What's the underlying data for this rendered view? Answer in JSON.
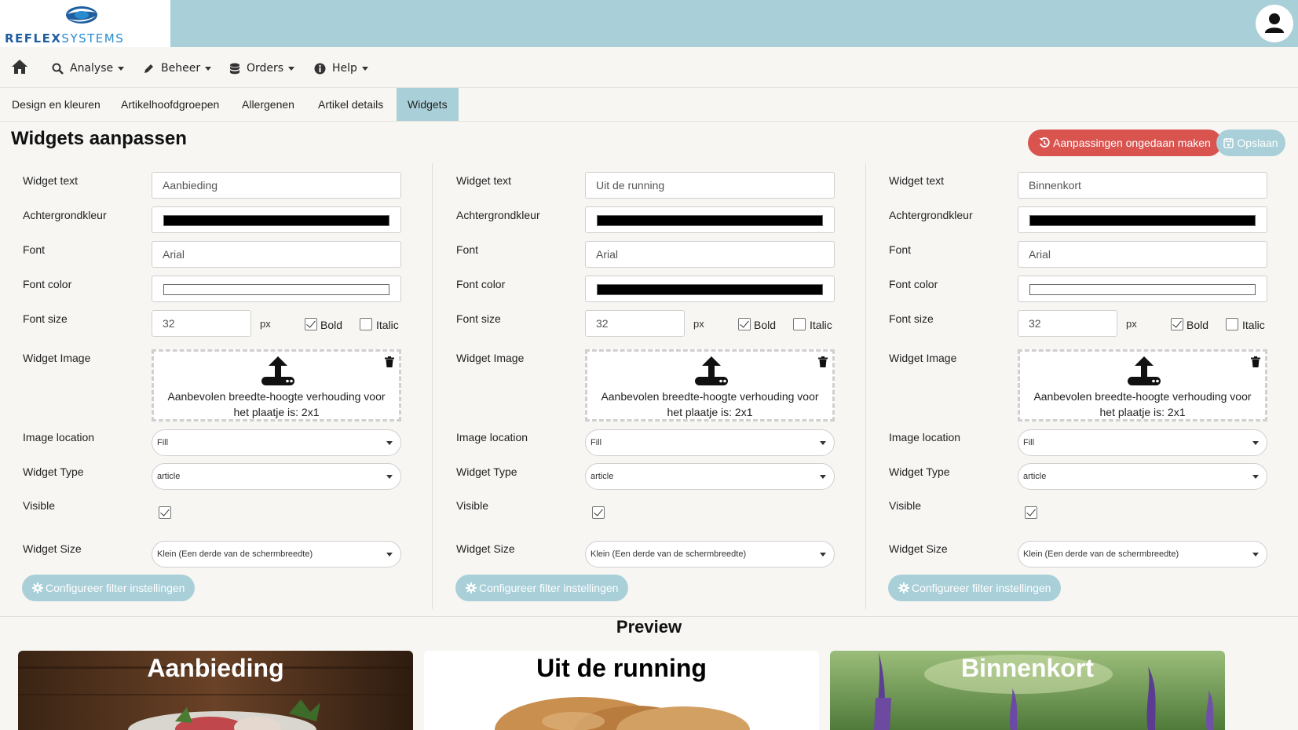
{
  "brand": {
    "name_part1": "REFLEX",
    "name_part2": "SYSTEMS"
  },
  "nav": {
    "items": [
      {
        "label": "Analyse",
        "icon": "search-icon"
      },
      {
        "label": "Beheer",
        "icon": "pencil-icon"
      },
      {
        "label": "Orders",
        "icon": "database-icon"
      },
      {
        "label": "Help",
        "icon": "info-icon"
      }
    ]
  },
  "tabs": [
    {
      "label": "Design en kleuren"
    },
    {
      "label": "Artikelhoofdgroepen"
    },
    {
      "label": "Allergenen"
    },
    {
      "label": "Artikel details"
    },
    {
      "label": "Widgets",
      "active": true
    }
  ],
  "page": {
    "title": "Widgets aanpassen",
    "undo_label": "Aanpassingen ongedaan maken",
    "save_label": "Opslaan"
  },
  "form_labels": {
    "widget_text": "Widget text",
    "background_color": "Achtergrondkleur",
    "font": "Font",
    "font_color": "Font color",
    "font_size": "Font size",
    "px": "px",
    "bold": "Bold",
    "italic": "Italic",
    "widget_image": "Widget Image",
    "image_hint": "Aanbevolen breedte-hoogte verhouding voor het plaatje is: 2x1",
    "image_location": "Image location",
    "widget_type": "Widget Type",
    "visible": "Visible",
    "widget_size": "Widget Size",
    "filter_button": "Configureer filter instellingen"
  },
  "widgets": [
    {
      "text": "Aanbieding",
      "background_color": "#000000",
      "font": "Arial",
      "font_color": "#ffffff",
      "font_size": "32",
      "bold": true,
      "italic": false,
      "image_location": "Fill",
      "widget_type": "article",
      "visible": true,
      "widget_size": "Klein (Een derde van de schermbreedte)"
    },
    {
      "text": "Uit de running",
      "background_color": "#000000",
      "font": "Arial",
      "font_color": "#000000",
      "font_size": "32",
      "bold": true,
      "italic": false,
      "image_location": "Fill",
      "widget_type": "article",
      "visible": true,
      "widget_size": "Klein (Een derde van de schermbreedte)"
    },
    {
      "text": "Binnenkort",
      "background_color": "#000000",
      "font": "Arial",
      "font_color": "#ffffff",
      "font_size": "32",
      "bold": true,
      "italic": false,
      "image_location": "Fill",
      "widget_type": "article",
      "visible": true,
      "widget_size": "Klein (Een derde van de schermbreedte)"
    }
  ],
  "preview": {
    "title": "Preview",
    "tiles": [
      {
        "text": "Aanbieding",
        "text_color": "#ffffff"
      },
      {
        "text": "Uit de running",
        "text_color": "#000000"
      },
      {
        "text": "Binnenkort",
        "text_color": "#ffffff"
      }
    ]
  },
  "colors": {
    "accent": "#a9cfd8",
    "danger": "#d9534f"
  }
}
